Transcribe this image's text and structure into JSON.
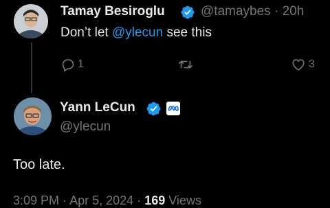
{
  "reply_to": {
    "name": "Tamay Besiroglu",
    "handle": "@tamaybes",
    "separator": "·",
    "time": "20h",
    "text_before": "Don’t let ",
    "mention": "@ylecun",
    "text_after": " see this",
    "reply_count": "1",
    "like_count": "3"
  },
  "main_tweet": {
    "name": "Yann LeCun",
    "handle": "@ylecun",
    "text": "Too late.",
    "time": "3:09 PM",
    "date": "Apr 5, 2024",
    "views_count": "169",
    "views_label": "Views",
    "dot": "·"
  },
  "colors": {
    "background": "#000000",
    "text": "#e7e9ea",
    "muted": "#71767b",
    "accent": "#1d9bf0",
    "verified": "#1d9bf0",
    "meta_logo": "#0866ff"
  },
  "icons": [
    "verified-badge-icon",
    "reply-icon",
    "retweet-icon",
    "like-icon",
    "meta-affiliation-icon"
  ]
}
